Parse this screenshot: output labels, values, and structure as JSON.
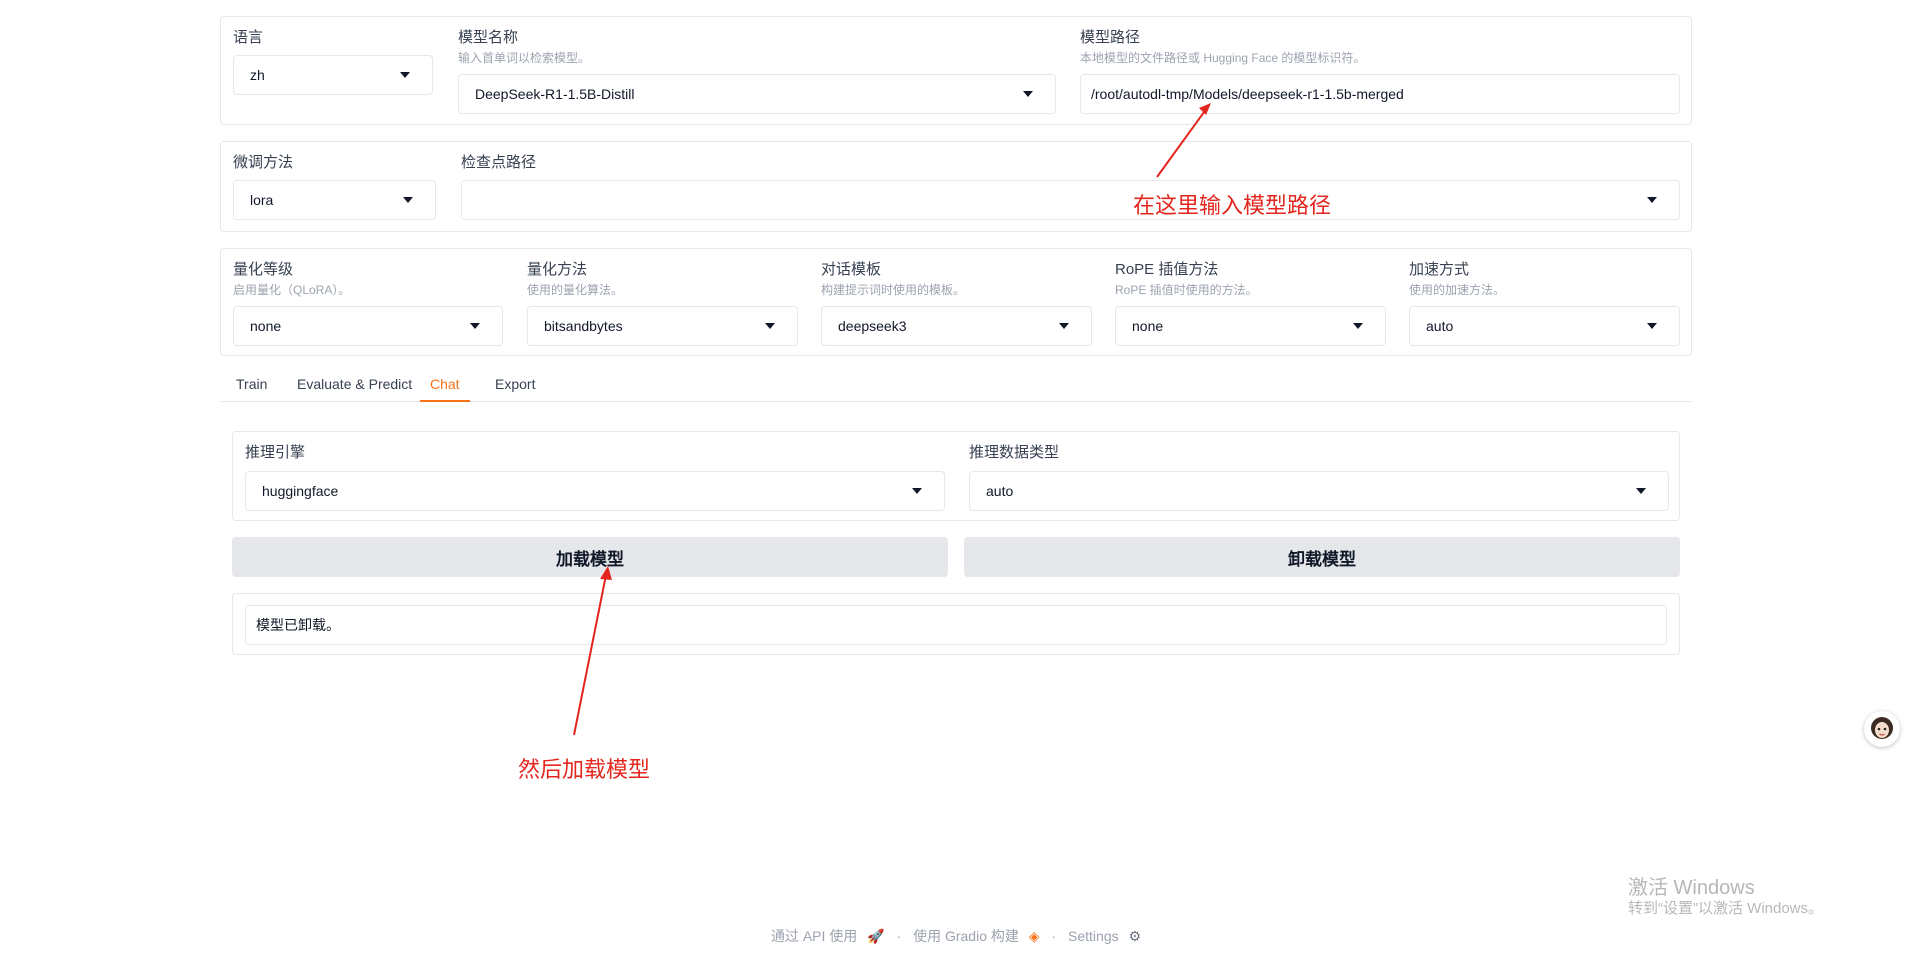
{
  "row1": {
    "lang": {
      "label": "语言",
      "value": "zh"
    },
    "model_name": {
      "label": "模型名称",
      "hint": "输入首单词以检索模型。",
      "value": "DeepSeek-R1-1.5B-Distill"
    },
    "model_path": {
      "label": "模型路径",
      "hint": "本地模型的文件路径或 Hugging Face 的模型标识符。",
      "value": "/root/autodl-tmp/Models/deepseek-r1-1.5b-merged"
    }
  },
  "row2": {
    "finetune": {
      "label": "微调方法",
      "value": "lora"
    },
    "checkpoint": {
      "label": "检查点路径",
      "value": ""
    }
  },
  "row3": {
    "quant_bit": {
      "label": "量化等级",
      "hint": "启用量化（QLoRA）。",
      "value": "none"
    },
    "quant_method": {
      "label": "量化方法",
      "hint": "使用的量化算法。",
      "value": "bitsandbytes"
    },
    "template": {
      "label": "对话模板",
      "hint": "构建提示词时使用的模板。",
      "value": "deepseek3"
    },
    "rope": {
      "label": "RoPE 插值方法",
      "hint": "RoPE 插值时使用的方法。",
      "value": "none"
    },
    "booster": {
      "label": "加速方式",
      "hint": "使用的加速方法。",
      "value": "auto"
    }
  },
  "tabs": [
    "Train",
    "Evaluate & Predict",
    "Chat",
    "Export"
  ],
  "active_tab": "Chat",
  "chat": {
    "infer_backend": {
      "label": "推理引擎",
      "value": "huggingface"
    },
    "infer_dtype": {
      "label": "推理数据类型",
      "value": "auto"
    },
    "load_btn": "加载模型",
    "unload_btn": "卸载模型",
    "info": "模型已卸载。"
  },
  "annotations": {
    "path_note": "在这里输入模型路径",
    "load_note": "然后加载模型"
  },
  "footer": {
    "api": "通过 API 使用",
    "gradio": "使用 Gradio 构建",
    "settings": "Settings"
  },
  "watermark": {
    "line1": "激活 Windows",
    "line2": "转到“设置”以激活 Windows。"
  },
  "colors": {
    "accent": "#f97316",
    "annotation": "#e3261e",
    "button": "#e5e7eb"
  }
}
